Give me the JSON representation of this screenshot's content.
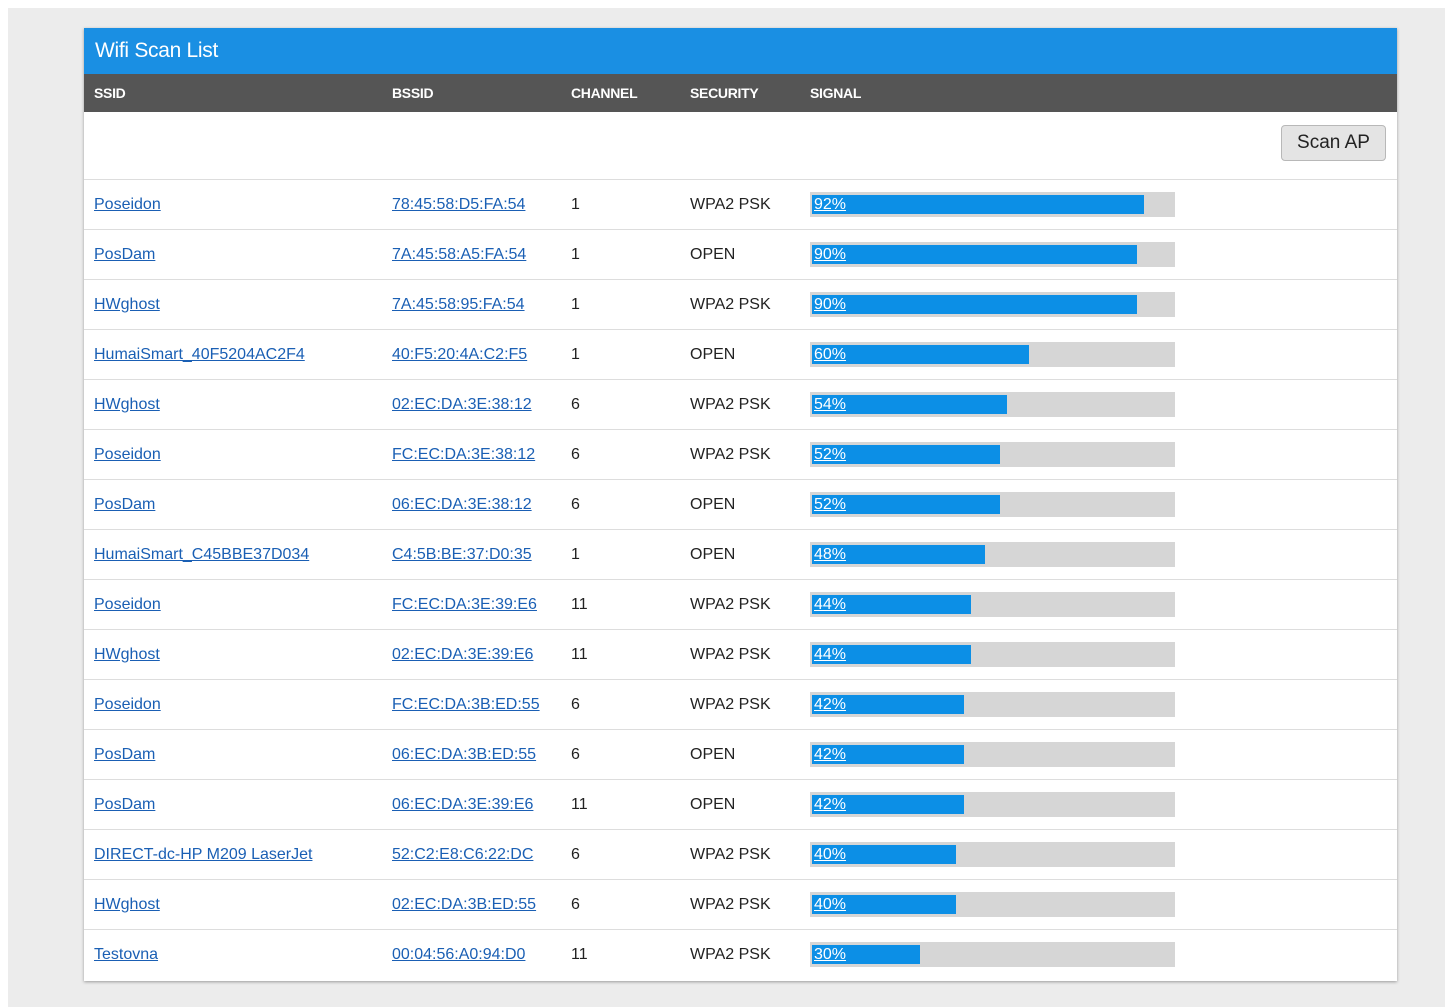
{
  "panel": {
    "title": "Wifi Scan List"
  },
  "columns": {
    "ssid": "SSID",
    "bssid": "BSSID",
    "channel": "CHANNEL",
    "security": "SECURITY",
    "signal": "SIGNAL"
  },
  "toolbar": {
    "scan_label": "Scan AP"
  },
  "colors": {
    "header_bg": "#1a8fe3",
    "column_header_bg": "#555555",
    "signal_fill": "#0c8fe6",
    "signal_track": "#d6d6d6",
    "link": "#1a5fb4"
  },
  "networks": [
    {
      "ssid": "Poseidon",
      "bssid": "78:45:58:D5:FA:54",
      "channel": "1",
      "security": "WPA2 PSK",
      "signal": 92,
      "signal_label": "92%"
    },
    {
      "ssid": "PosDam",
      "bssid": "7A:45:58:A5:FA:54",
      "channel": "1",
      "security": "OPEN",
      "signal": 90,
      "signal_label": "90%"
    },
    {
      "ssid": "HWghost",
      "bssid": "7A:45:58:95:FA:54",
      "channel": "1",
      "security": "WPA2 PSK",
      "signal": 90,
      "signal_label": "90%"
    },
    {
      "ssid": "HumaiSmart_40F5204AC2F4",
      "bssid": "40:F5:20:4A:C2:F5",
      "channel": "1",
      "security": "OPEN",
      "signal": 60,
      "signal_label": "60%"
    },
    {
      "ssid": "HWghost",
      "bssid": "02:EC:DA:3E:38:12",
      "channel": "6",
      "security": "WPA2 PSK",
      "signal": 54,
      "signal_label": "54%"
    },
    {
      "ssid": "Poseidon",
      "bssid": "FC:EC:DA:3E:38:12",
      "channel": "6",
      "security": "WPA2 PSK",
      "signal": 52,
      "signal_label": "52%"
    },
    {
      "ssid": "PosDam",
      "bssid": "06:EC:DA:3E:38:12",
      "channel": "6",
      "security": "OPEN",
      "signal": 52,
      "signal_label": "52%"
    },
    {
      "ssid": "HumaiSmart_C45BBE37D034",
      "bssid": "C4:5B:BE:37:D0:35",
      "channel": "1",
      "security": "OPEN",
      "signal": 48,
      "signal_label": "48%"
    },
    {
      "ssid": "Poseidon",
      "bssid": "FC:EC:DA:3E:39:E6",
      "channel": "11",
      "security": "WPA2 PSK",
      "signal": 44,
      "signal_label": "44%"
    },
    {
      "ssid": "HWghost",
      "bssid": "02:EC:DA:3E:39:E6",
      "channel": "11",
      "security": "WPA2 PSK",
      "signal": 44,
      "signal_label": "44%"
    },
    {
      "ssid": "Poseidon",
      "bssid": "FC:EC:DA:3B:ED:55",
      "channel": "6",
      "security": "WPA2 PSK",
      "signal": 42,
      "signal_label": "42%"
    },
    {
      "ssid": "PosDam",
      "bssid": "06:EC:DA:3B:ED:55",
      "channel": "6",
      "security": "OPEN",
      "signal": 42,
      "signal_label": "42%"
    },
    {
      "ssid": "PosDam",
      "bssid": "06:EC:DA:3E:39:E6",
      "channel": "11",
      "security": "OPEN",
      "signal": 42,
      "signal_label": "42%"
    },
    {
      "ssid": "DIRECT-dc-HP M209 LaserJet",
      "bssid": "52:C2:E8:C6:22:DC",
      "channel": "6",
      "security": "WPA2 PSK",
      "signal": 40,
      "signal_label": "40%"
    },
    {
      "ssid": "HWghost",
      "bssid": "02:EC:DA:3B:ED:55",
      "channel": "6",
      "security": "WPA2 PSK",
      "signal": 40,
      "signal_label": "40%"
    },
    {
      "ssid": "Testovna",
      "bssid": "00:04:56:A0:94:D0",
      "channel": "11",
      "security": "WPA2 PSK",
      "signal": 30,
      "signal_label": "30%"
    }
  ]
}
